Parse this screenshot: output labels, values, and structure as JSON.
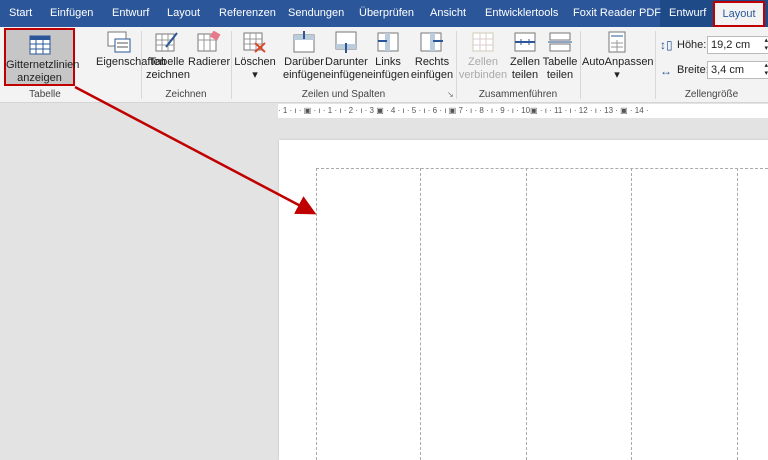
{
  "tabs": [
    "Start",
    "Einfügen",
    "Entwurf",
    "Layout",
    "Referenzen",
    "Sendungen",
    "Überprüfen",
    "Ansicht",
    "Entwicklertools",
    "Foxit Reader PDF",
    "Entwurf",
    "Layout"
  ],
  "ribbon": {
    "tabelle": {
      "gitternetz": "Gitternetzlinien anzeigen",
      "gitternetz1": "Gitternetzlinien",
      "gitternetz2": "anzeigen",
      "eigenschaften": "Eigenschaften",
      "label": "Tabelle"
    },
    "zeichnen": {
      "t1": "Tabelle",
      "t2": "zeichnen",
      "radierer": "Radierer",
      "label": "Zeichnen"
    },
    "zeilen": {
      "loeschen": "Löschen",
      "d1": "Darüber",
      "d2": "einfügen",
      "u1": "Darunter",
      "u2": "einfügen",
      "l1": "Links",
      "l2": "einfügen",
      "r1": "Rechts",
      "r2": "einfügen",
      "label": "Zeilen und Spalten"
    },
    "zusammen": {
      "z1": "Zellen",
      "z2": "verbinden",
      "t1": "Zellen",
      "t2": "teilen",
      "s1": "Tabelle",
      "s2": "teilen",
      "label": "Zusammenführen"
    },
    "auto": {
      "label": "AutoAnpassen"
    },
    "groesse": {
      "hoehe_label": "Höhe:",
      "hoehe": "19,2 cm",
      "breite_label": "Breite:",
      "breite": "3,4 cm",
      "label": "Zellengröße"
    }
  },
  "ruler": "· 1 · ı · ▣ · ı · 1 · ı · 2 · ı · 3 ▣ · 4 · ı · 5 · ı · 6 · ı ▣ 7 · ı · 8 · ı · 9 · ı · 10▣ · ı · 11 · ı · 12 · ı · 13 · ▣ · 14 ·",
  "colors": {
    "tabbar": "#2b579a",
    "highlight": "#c00000"
  }
}
